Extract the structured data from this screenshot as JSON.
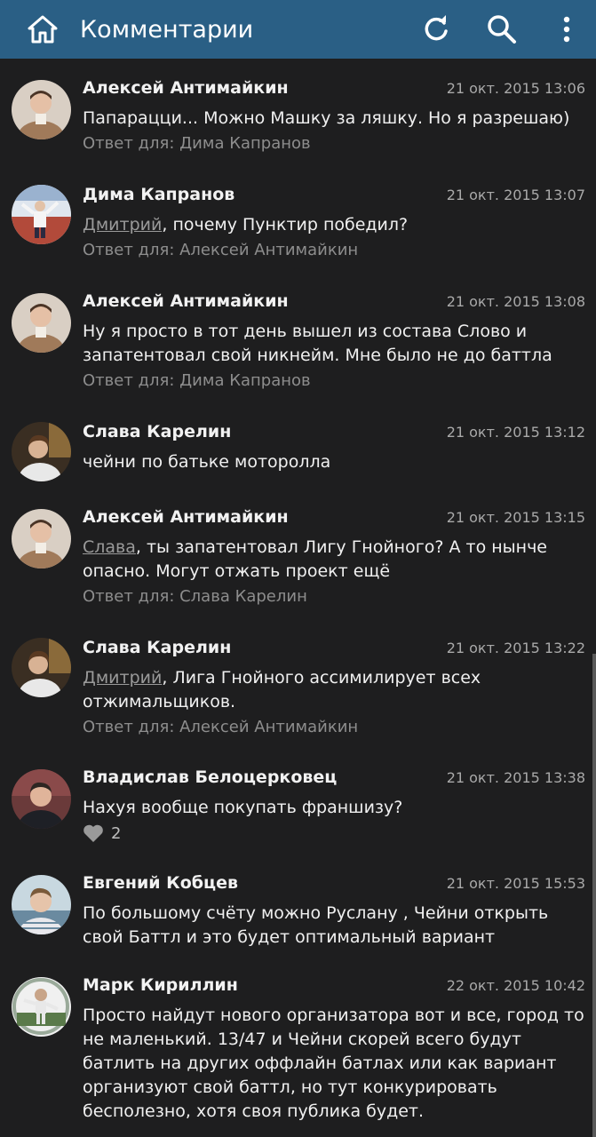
{
  "header": {
    "title": "Комментарии",
    "icons": [
      "home-icon",
      "refresh-icon",
      "search-icon",
      "more-vertical-icon"
    ],
    "background": "#2a5f85"
  },
  "comments": [
    {
      "author": "Алексей Антимайкин",
      "date": "21 окт. 2015 13:06",
      "mention": "",
      "text": "Папарацци... Можно Машку за ляшку. Но я разрешаю)",
      "reply_to": "Ответ для: Дима Капранов",
      "avatar_color": "#a07a5a",
      "avatar_icon": "avatar-icon"
    },
    {
      "author": "Дима Капранов",
      "date": "21 окт. 2015 13:07",
      "mention": "Дмитрий",
      "text": ", почему Пунктир победил?",
      "reply_to": "Ответ для: Алексей Антимайкин",
      "avatar_color": "#8a4a4a",
      "avatar_icon": "avatar-icon"
    },
    {
      "author": "Алексей Антимайкин",
      "date": "21 окт. 2015 13:08",
      "mention": "",
      "text": "Ну  я просто в тот день вышел из состава Слово и запатентовал свой никнейм. Мне было не до баттла",
      "reply_to": "Ответ для: Дима Капранов",
      "avatar_color": "#a07a5a",
      "avatar_icon": "avatar-icon"
    },
    {
      "author": "Слава Карелин",
      "date": "21 окт. 2015 13:12",
      "mention": "",
      "text": "чейни по батьке моторолла",
      "reply_to": "",
      "avatar_color": "#6a5a3a",
      "avatar_icon": "avatar-icon"
    },
    {
      "author": "Алексей Антимайкин",
      "date": "21 окт. 2015 13:15",
      "mention": "Слава",
      "text": ", ты запатентовал Лигу Гнойного? А то нынче опасно. Могут отжать проект ещё",
      "reply_to": "Ответ для: Слава Карелин",
      "avatar_color": "#a07a5a",
      "avatar_icon": "avatar-icon"
    },
    {
      "author": "Слава Карелин",
      "date": "21 окт. 2015 13:22",
      "mention": "Дмитрий",
      "text": ", Лига Гнойного ассимилирует всех отжимальщиков.",
      "reply_to": "Ответ для: Алексей Антимайкин",
      "avatar_color": "#6a5a3a",
      "avatar_icon": "avatar-icon"
    },
    {
      "author": "Владислав Белоцерковец",
      "date": "21 окт. 2015 13:38",
      "mention": "",
      "text": "Нахуя вообще покупать франшизу?",
      "reply_to": "",
      "likes": "2",
      "avatar_color": "#5a3a3a",
      "avatar_icon": "avatar-icon"
    },
    {
      "author": "Евгений Кобцев",
      "date": "21 окт. 2015 15:53",
      "mention": "",
      "text": "По большому счёту можно Руслану , Чейни открыть свой Баттл и это будет оптимальный вариант",
      "reply_to": "",
      "avatar_color": "#5a6a7a",
      "avatar_icon": "avatar-icon"
    },
    {
      "author": "Марк Кириллин",
      "date": "22 окт. 2015 10:42",
      "mention": "",
      "text": "Просто найдут нового организатора вот и все, город то не маленький. 13/47 и Чейни скорей всего будут батлить на других оффлайн батлах или как вариант организуют свой баттл, но тут конкурировать бесполезно, хотя своя публика будет.",
      "reply_to": "",
      "avatar_color": "#8a9a8a",
      "avatar_icon": "avatar-icon"
    }
  ]
}
